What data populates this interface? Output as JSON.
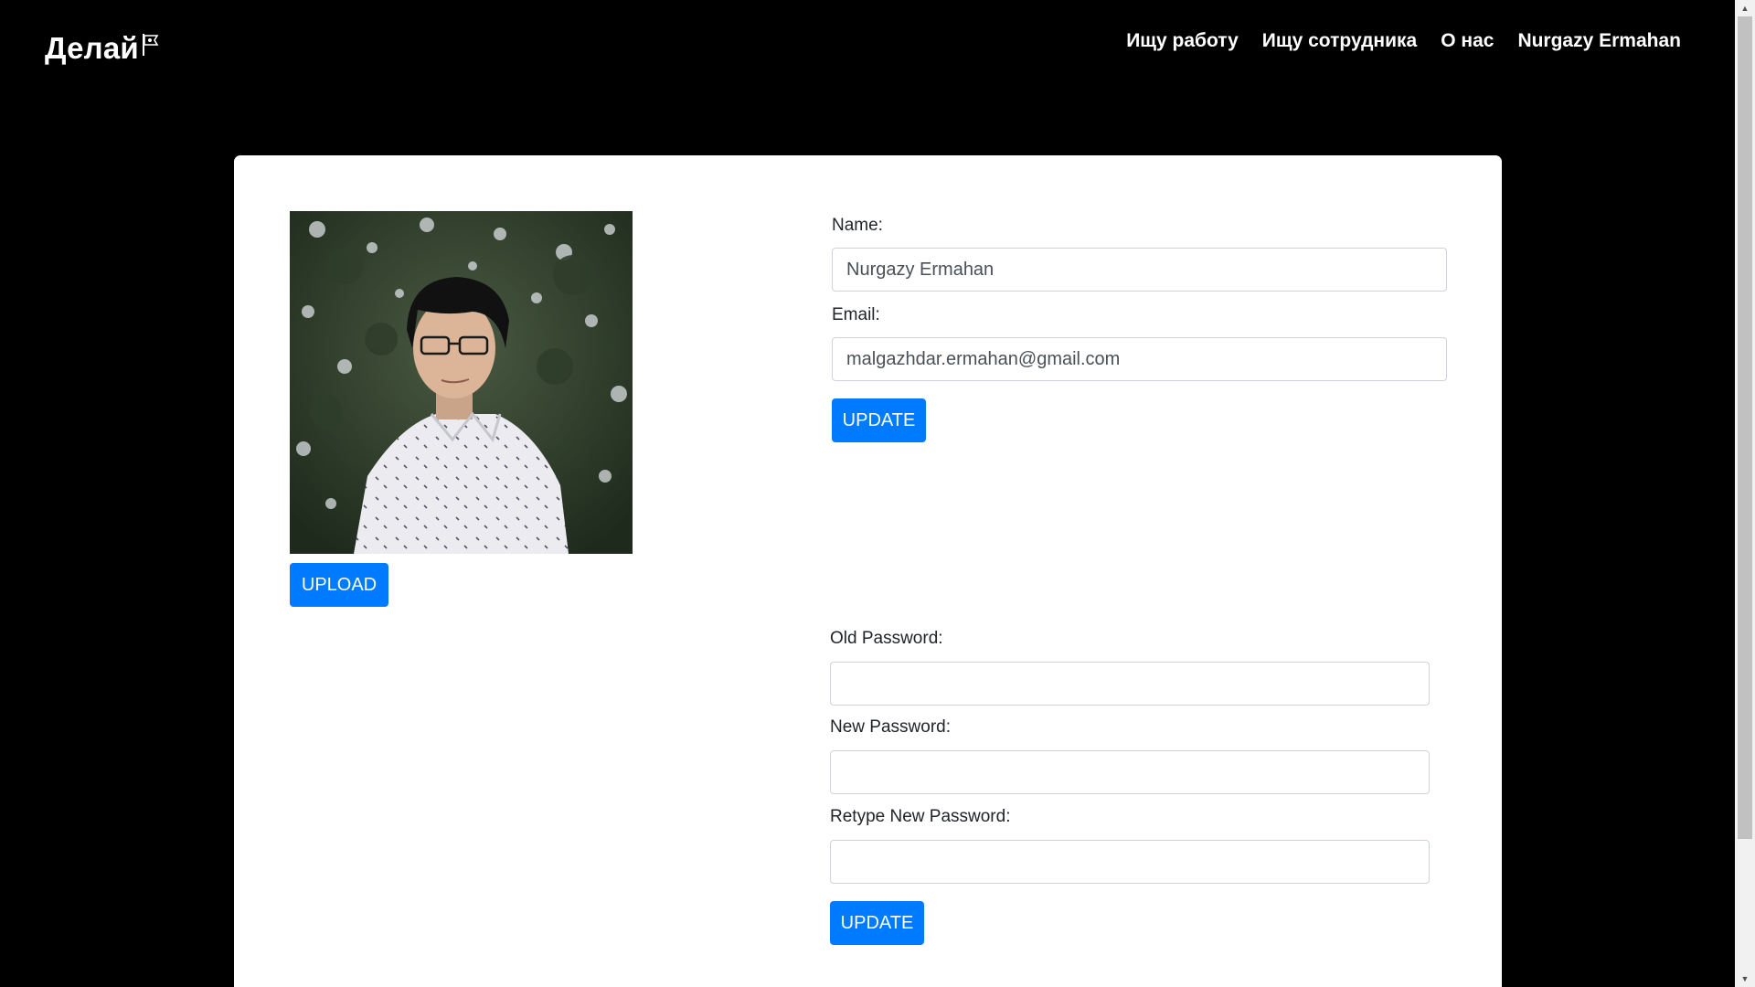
{
  "brand": {
    "title": "Делай"
  },
  "nav": {
    "items": [
      "Ищу работу",
      "Ищу сотрудника",
      "О нас",
      "Nurgazy Ermahan"
    ]
  },
  "profile": {
    "upload_label": "UPLOAD",
    "name_label": "Name:",
    "name_value": "Nurgazy Ermahan",
    "email_label": "Email:",
    "email_value": "malgazhdar.ermahan@gmail.com",
    "update_label": "UPDATE"
  },
  "password": {
    "old_label": "Old Password:",
    "new_label": "New Password:",
    "retype_label": "Retype New Password:",
    "old_value": "",
    "new_value": "",
    "retype_value": "",
    "update_label": "UPDATE"
  },
  "colors": {
    "background": "#000000",
    "card": "#ffffff",
    "primary": "#007bff"
  }
}
